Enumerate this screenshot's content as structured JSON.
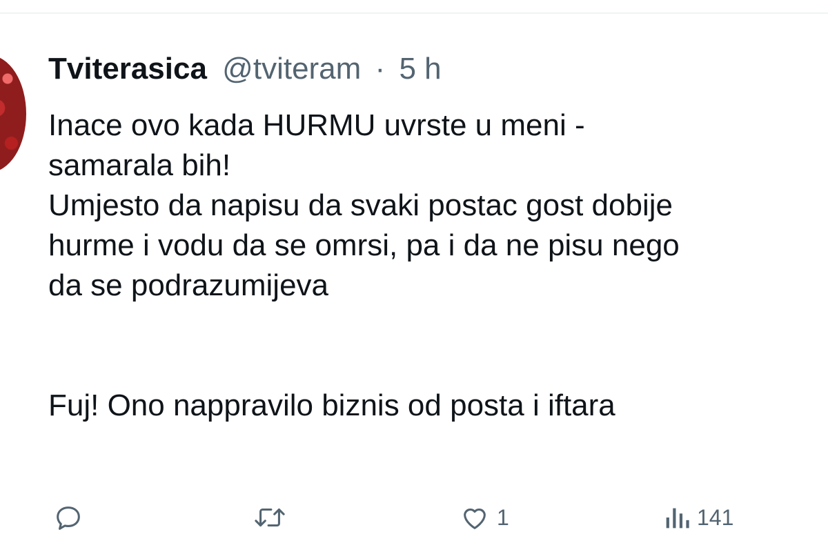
{
  "tweet": {
    "display_name": "Tviterasica",
    "handle": "@tviteram",
    "separator": "·",
    "time": "5 h",
    "lines": [
      "Inace ovo kada HURMU uvrste u meni -",
      "samarala bih!",
      "Umjesto da napisu da svaki postac gost dobije",
      "hurme i vodu da se omrsi, pa i da ne pisu nego",
      "da se podrazumijeva",
      "Fuj! Ono nappravilo biznis od posta i iftara"
    ]
  },
  "actions": {
    "reply": {
      "icon": "reply-icon"
    },
    "retweet": {
      "icon": "retweet-icon"
    },
    "like": {
      "icon": "heart-icon",
      "count": "1"
    },
    "views": {
      "icon": "views-icon",
      "count": "141"
    }
  },
  "colors": {
    "text": "#0f1419",
    "muted": "#536471",
    "divider": "#eff3f4"
  }
}
